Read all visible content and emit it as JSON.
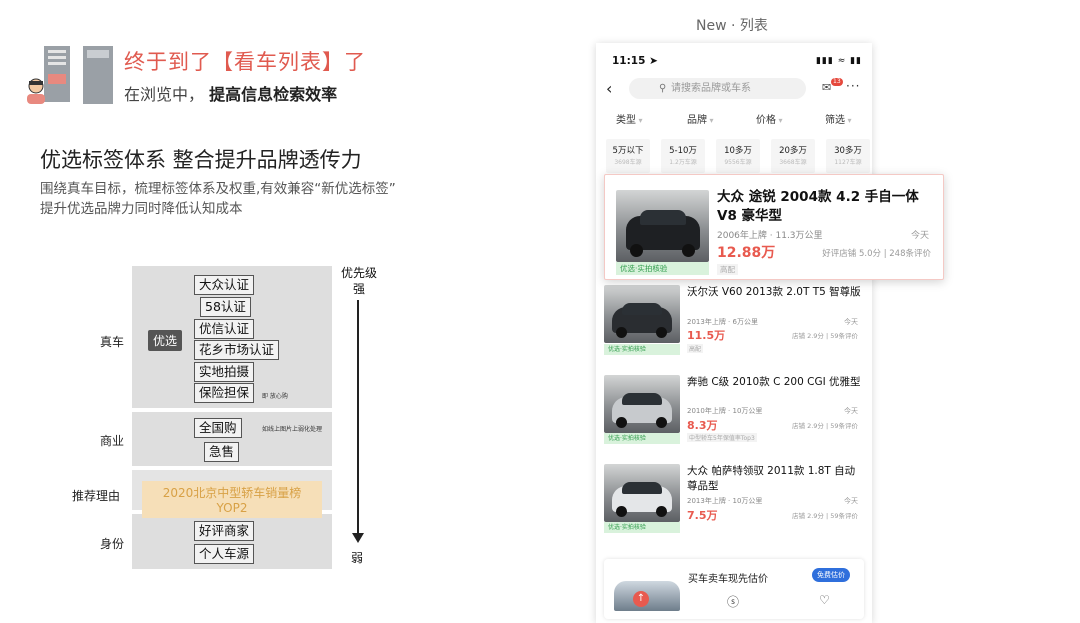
{
  "header": {
    "title": "终于到了【看车列表】了",
    "subtitle_prefix": "在浏览中， 提高",
    "subtitle_bold": "提高信息检索效率"
  },
  "section": {
    "title": "优选标签体系 整合提升品牌透传力",
    "desc_line1": "围绕真车目标，梳理标签体系及权重,有效兼容“新优选标签”",
    "desc_line2": "提升优选品牌力同时降低认知成本"
  },
  "diagram": {
    "rows": {
      "real_car": "真车",
      "business": "商业",
      "reason": "推荐理由",
      "identity": "身份"
    },
    "pick_badge": "优选",
    "real_car_tags": [
      "大众认证",
      "58认证",
      "优信认证",
      "花乡市场认证",
      "实地拍摄",
      "保险担保"
    ],
    "worry_free_note": "即 放心购",
    "business_tags": [
      "全国购",
      "急售"
    ],
    "business_note": "如线上图片上弱化处理",
    "reason_tag": "2020北京中型轿车销量榜YOP2",
    "identity_tags": [
      "好评商家",
      "个人车源"
    ],
    "priority_top_1": "优先级",
    "priority_top_2": "强",
    "priority_bottom": "弱"
  },
  "phone": {
    "caption": "New · 列表",
    "time": "11:15",
    "search_placeholder": "请搜索品牌或车系",
    "msg_count": "13",
    "filters": [
      "类型",
      "品牌",
      "价格",
      "筛选"
    ],
    "price_chips": [
      {
        "price": "5万以下",
        "count": "3698车源"
      },
      {
        "price": "5-10万",
        "count": "1.2万车源"
      },
      {
        "price": "10多万",
        "count": "9556车源"
      },
      {
        "price": "20多万",
        "count": "3668车源"
      },
      {
        "price": "30多万",
        "count": "1127车源"
      }
    ],
    "verified_label": "优选·实拍核验",
    "featured": {
      "title": "大众 途锐 2004款 4.2 手自一体 V8 豪华型",
      "meta": "2006年上牌 · 11.3万公里",
      "date": "今天",
      "price": "12.88万",
      "shop": "好评店铺 5.0分 | 248条评价",
      "tag": "高配"
    },
    "cars": [
      {
        "title": "沃尔沃 V60 2013款 2.0T T5 智尊版",
        "meta": "2013年上牌 · 6万公里",
        "date": "今天",
        "price": "11.5万",
        "shop": "店铺 2.9分 | 59条评价",
        "tag": "高配"
      },
      {
        "title": "奔驰 C级 2010款 C 200 CGI 优雅型",
        "meta": "2010年上牌 · 10万公里",
        "date": "今天",
        "price": "8.3万",
        "shop": "店铺 2.9分 | 59条评价",
        "tag": "中型轿车5年保值率Top3"
      },
      {
        "title": "大众 帕萨特领驭 2011款 1.8T 自动尊品型",
        "meta": "2013年上牌 · 10万公里",
        "date": "今天",
        "price": "7.5万",
        "shop": "店铺 2.9分 | 59条评价",
        "tag": ""
      }
    ],
    "sell_card": {
      "text": "买车卖车现先估价",
      "button": "免费估价"
    }
  },
  "colors": {
    "accent": "#e05a4f",
    "price": "#e85a4f",
    "verified": "#2f9c4b",
    "blue": "#2f6fdc"
  }
}
